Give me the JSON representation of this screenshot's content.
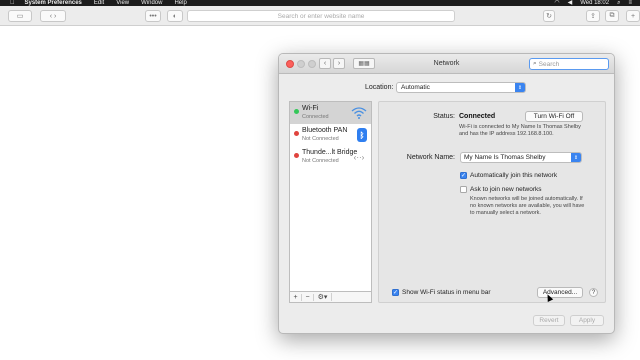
{
  "menubar": {
    "apple": "",
    "app_name": "System Preferences",
    "menus": [
      "Edit",
      "View",
      "Window",
      "Help"
    ],
    "clock": "Wed 18:02"
  },
  "browser": {
    "address_placeholder": "Search or enter website name",
    "reader_label": "•••"
  },
  "window": {
    "title": "Network",
    "search_placeholder": "Search",
    "location_label": "Location:",
    "location_value": "Automatic"
  },
  "services": [
    {
      "name": "Wi-Fi",
      "status": "Connected",
      "dot_color": "#34c759",
      "icon": "wifi-icon"
    },
    {
      "name": "Bluetooth PAN",
      "status": "Not Connected",
      "dot_color": "#e0443e",
      "icon": "bluetooth-icon"
    },
    {
      "name": "Thunde...lt Bridge",
      "status": "Not Connected",
      "dot_color": "#e0443e",
      "icon": "thunderbolt-bridge-icon"
    }
  ],
  "list_controls": {
    "add": "+",
    "remove": "−",
    "gear": "⚙▾"
  },
  "detail": {
    "status_label": "Status:",
    "status_value": "Connected",
    "turn_off_label": "Turn Wi-Fi Off",
    "status_desc": "Wi-Fi is connected to My Name Is Thomas Shelby and has the IP address 192.168.8.100.",
    "network_name_label": "Network Name:",
    "network_name_value": "My Name Is Thomas Shelby",
    "auto_join_label": "Automatically join this network",
    "auto_join_checked": true,
    "ask_join_label": "Ask to join new networks",
    "ask_join_checked": false,
    "ask_join_desc": "Known networks will be joined automatically. If no known networks are available, you will have to manually select a network.",
    "menu_bar_label": "Show Wi-Fi status in menu bar",
    "menu_bar_checked": true,
    "advanced_label": "Advanced...",
    "help_label": "?"
  },
  "footer": {
    "revert_label": "Revert",
    "apply_label": "Apply"
  },
  "colors": {
    "accent": "#3a84f0",
    "connected": "#34c759",
    "disconnected": "#e0443e"
  }
}
